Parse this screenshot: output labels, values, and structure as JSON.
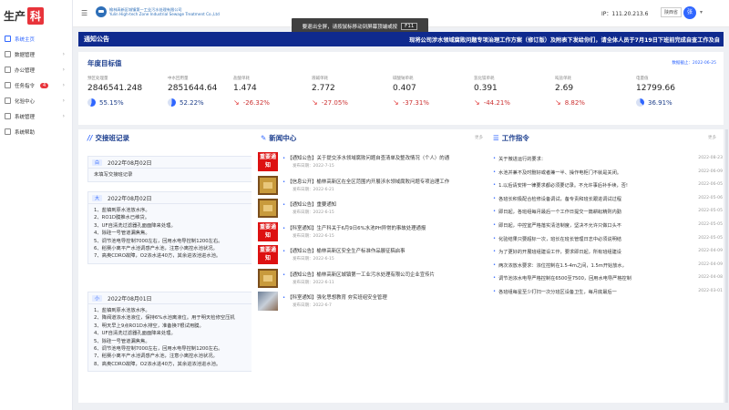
{
  "sidebar": {
    "logo_text": "生产",
    "logo_box": "科",
    "items": [
      {
        "label": "系统主页",
        "active": true,
        "chevron": false
      },
      {
        "label": "数据管理",
        "chevron": true
      },
      {
        "label": "办公管理",
        "chevron": true
      },
      {
        "label": "任务指令",
        "chevron": true,
        "badge": "4"
      },
      {
        "label": "化验中心",
        "chevron": true
      },
      {
        "label": "系统管理",
        "chevron": true
      },
      {
        "label": "系统帮助",
        "chevron": false
      }
    ]
  },
  "header": {
    "menu_icon": "☰",
    "brand_line1": "榆林高新区城镇第一工业污水处理有限公司",
    "brand_line2": "Yulin High-tech Zone Industrial Sewage Treatment Co.,Ltd",
    "ip": "IP：111.20.213.6",
    "region": "陕西省",
    "avatar": "张",
    "caret": "▾"
  },
  "toast": {
    "text": "要退出全屏，请按鼠标移动到屏幕顶端或按",
    "key": "F11"
  },
  "notice": {
    "title": "通知公告",
    "text": "现将公司涉水领域腐败问题专项治理工作方案（修订版）及附表下发给你们，请全体人员于7月19日下班前完成自查工作及自"
  },
  "goals": {
    "title": "年度目标值",
    "date": "数据截止：2022-06-25",
    "items": [
      {
        "label": "预区处理量",
        "value": "2846541.248",
        "pct": "55.15%",
        "trend": "up",
        "fill": 0.55
      },
      {
        "label": "中水回用量",
        "value": "2851644.64",
        "pct": "52.22%",
        "trend": "up",
        "fill": 0.52
      },
      {
        "label": "盐酸单耗",
        "value": "1.474",
        "pct": "-26.32%",
        "trend": "down"
      },
      {
        "label": "液碱单耗",
        "value": "2.772",
        "pct": "-27.05%",
        "trend": "down"
      },
      {
        "label": "碳酸钠单耗",
        "value": "0.407",
        "pct": "-37.31%",
        "trend": "down"
      },
      {
        "label": "氢化镁单耗",
        "value": "0.391",
        "pct": "-44.21%",
        "trend": "down"
      },
      {
        "label": "吨盐单耗",
        "value": "2.69",
        "pct": "8.82%",
        "trend": "down"
      },
      {
        "label": "电量值",
        "value": "12799.66",
        "pct": "36.91%",
        "trend": "up",
        "fill": 0.37
      }
    ]
  },
  "handover": {
    "title": "交接班记录",
    "more": "更多",
    "deco": "//",
    "records": [
      {
        "shift": "白",
        "date": "2022年08月02日",
        "user": "彭成川",
        "lines": [
          "未填写交接班记录"
        ]
      },
      {
        "shift": "大",
        "date": "2022年08月02日",
        "user": "董文",
        "lines": [
          "1、盐镇到原水池放水序。",
          "2、RO1D膜推水已维贷。",
          "3、UF自清洗过滤器孔面面降来处理。",
          "4、除硅一号管道漏焦焦。",
          "5、调节池电导控制7000左右，回用水电导控制1200左右。",
          "6、稻赛小离平产水池调感产水池，注意小离控水池状况。",
          "7、高奥CDRO故障，O2浓水进40方，其余进浓池进水池。"
        ]
      },
      {
        "shift": "小",
        "date": "2022年08月01日",
        "user": "贾新春",
        "lines": [
          "1、盐镇到原水池放水序。",
          "2、降阀道浓水池液位，保持6%水池离液位。用于明天检修空压机",
          "3、明天早上9点RO1D水排空，准备换7根试用膜。",
          "4、UF自清洗过滤器孔面面降来处理。",
          "5、除硅一号管道漏焦焦。",
          "6、调节池电导控制7000左右，回用水电导控制1200左右。",
          "7、稻赛小离平产水池调感产水池，注意小离控水池状况。",
          "8、高奥CDRO故障，O2浓水进40方，其余进浓池进水池。"
        ]
      }
    ]
  },
  "news": {
    "title": "新闻中心",
    "more": "更多",
    "items": [
      {
        "thumb": "red",
        "thumb_text": "重要通知",
        "title": "【通知公告】关于提交涉水领域腐败问题自查清单及整改情况（个人）的通",
        "date": "发布日期：2022-7-15"
      },
      {
        "thumb": "tan",
        "title": "【信息公开】榆林高新区在全区范围内开展涉水领域腐败问题专项治理工作",
        "date": "发布日期：2022-6-21"
      },
      {
        "thumb": "tan",
        "title": "【通知公告】重要通知",
        "date": "发布日期：2022-6-15"
      },
      {
        "thumb": "red",
        "thumb_text": "重要通知",
        "title": "【科室通知】生产科关于6月9日6%水池PH异常的事故处理通报",
        "date": "发布日期：2022-6-15"
      },
      {
        "thumb": "red",
        "thumb_text": "重要通知",
        "title": "【通知公告】榆林高新区安全生产标准作品展征稿启事",
        "date": "发布日期：2022-6-15"
      },
      {
        "thumb": "tan",
        "title": "【通知公告】榆林高新区城镇第一工业污水处理有限公司企业宣传片",
        "date": "发布日期：2022-6-11"
      },
      {
        "thumb": "photo",
        "title": "【科室通知】强化思想教育 夯实班组安全管理",
        "date": "发布日期：2022-6-7"
      }
    ]
  },
  "instructions": {
    "title": "工作指令",
    "more": "更多",
    "items": [
      {
        "text": "关于微进运行的要求：",
        "date": "2022-08-23"
      },
      {
        "text": "水池并兼不及时删好或者兼一半、操作电柜门不就是关闭。",
        "date": "2022-06-09"
      },
      {
        "text": "1.以后请安排一律要求都必须要记录。不允许事后补手续，否!",
        "date": "2022-06-05"
      },
      {
        "text": "各班长积极配合检修设备调试，备专责和班长跟进调试过程",
        "date": "2022-05-06"
      },
      {
        "text": "即日起，各班组每月最后一个工作日提交一篇耕耘精则内勤",
        "date": "2022-05-05"
      },
      {
        "text": "即日起，中控室严格落实清洁制度，坚决不允许只做口头不",
        "date": "2022-05-05"
      },
      {
        "text": "化验结果只要超标一次，班长在班长管理日志中必须说明结",
        "date": "2022-05-05"
      },
      {
        "text": "为了更好的开展班组建设工作，要求即日起，所有班组建设",
        "date": "2022-04-09"
      },
      {
        "text": "两次浓放水要求：浓位控制在1.5-4m之间，1.5m开始放水，",
        "date": "2022-04-09"
      },
      {
        "text": "调节池浓水电导严格控制在6500至7500，回用水电导严格控制",
        "date": "2022-04-08"
      },
      {
        "text": "各班组每星至少打扫一次分班区设备卫生，每月底最后一",
        "date": "2022-03-01"
      }
    ]
  },
  "colors": {
    "accent": "#2f66ff",
    "notice_bg": "#0f2a8e",
    "title": "#1d3f8f",
    "up": "#1e3f8a",
    "down": "#cc3333"
  }
}
